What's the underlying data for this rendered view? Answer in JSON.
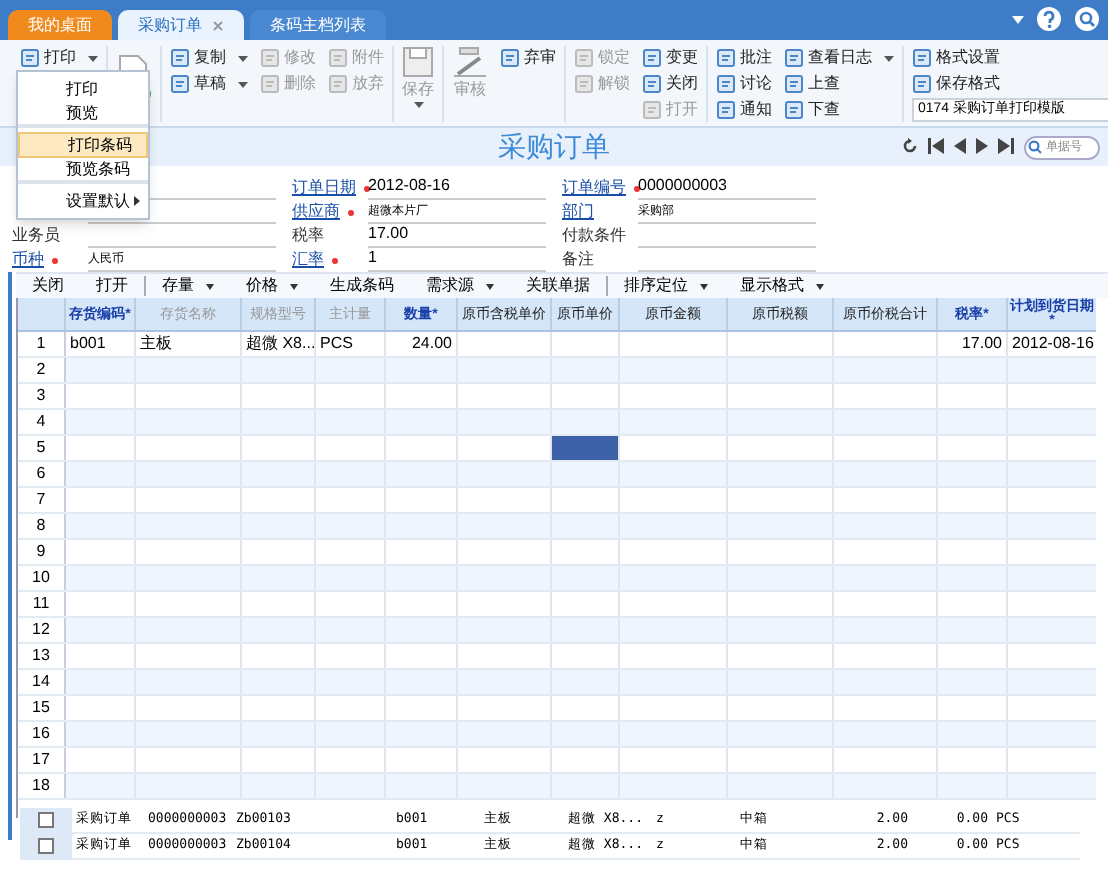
{
  "tabs": [
    {
      "label": "我的桌面",
      "selected": false,
      "kind": "home"
    },
    {
      "label": "采购订单",
      "selected": true,
      "kind": "doc",
      "closable": true
    },
    {
      "label": "条码主档列表",
      "selected": false,
      "kind": "doc"
    }
  ],
  "ribbon": {
    "groups": [
      {
        "columns": [
          [
            {
              "kind": "small",
              "label": "打印",
              "dropdown": true,
              "disabled": false
            }
          ]
        ]
      },
      {
        "columns": [
          [
            {
              "kind": "new"
            }
          ]
        ]
      },
      {
        "columns": [
          [
            {
              "kind": "small",
              "label": "复制",
              "dropdown": true,
              "disabled": false
            },
            {
              "kind": "small",
              "label": "草稿",
              "dropdown": true,
              "disabled": false
            }
          ],
          [
            {
              "kind": "small",
              "label": "修改",
              "disabled": true
            },
            {
              "kind": "small",
              "label": "删除",
              "disabled": true
            }
          ],
          [
            {
              "kind": "small",
              "label": "附件",
              "disabled": true
            },
            {
              "kind": "small",
              "label": "放弃",
              "disabled": true
            }
          ]
        ]
      },
      {
        "columns": [
          [
            {
              "kind": "save",
              "label": "保存",
              "dropdown": true,
              "disabled": true
            }
          ]
        ]
      },
      {
        "columns": [
          [
            {
              "kind": "approve",
              "label": "审核",
              "disabled": true
            }
          ],
          [
            {
              "kind": "small",
              "label": "弃审",
              "disabled": false
            }
          ]
        ]
      },
      {
        "columns": [
          [
            {
              "kind": "small",
              "label": "锁定",
              "disabled": true
            },
            {
              "kind": "small",
              "label": "解锁",
              "disabled": true
            }
          ],
          [
            {
              "kind": "small",
              "label": "变更",
              "disabled": false
            },
            {
              "kind": "small",
              "label": "关闭",
              "disabled": false
            },
            {
              "kind": "small",
              "label": "打开",
              "disabled": true
            }
          ]
        ]
      },
      {
        "columns": [
          [
            {
              "kind": "small",
              "label": "批注",
              "disabled": false
            },
            {
              "kind": "small",
              "label": "讨论",
              "disabled": false
            },
            {
              "kind": "small",
              "label": "通知",
              "disabled": false
            }
          ],
          [
            {
              "kind": "small",
              "label": "查看日志",
              "dropdown": true,
              "disabled": false
            },
            {
              "kind": "small",
              "label": "上查",
              "disabled": false
            },
            {
              "kind": "small",
              "label": "下查",
              "disabled": false
            }
          ]
        ]
      },
      {
        "columns": [
          [
            {
              "kind": "small",
              "label": "格式设置",
              "disabled": false
            },
            {
              "kind": "small",
              "label": "保存格式",
              "disabled": false
            },
            {
              "kind": "select",
              "value": "0174 采购订单打印模版"
            }
          ]
        ]
      }
    ]
  },
  "menu": [
    {
      "label": "打印",
      "selected": false
    },
    {
      "label": "预览",
      "selected": false,
      "separator_after": true
    },
    {
      "label": "打印条码",
      "selected": true
    },
    {
      "label": "预览条码",
      "selected": false,
      "separator_after": true
    },
    {
      "label": "设置默认",
      "selected": false,
      "submenu": true
    }
  ],
  "form": {
    "title": "采购订单",
    "search": {
      "placeholder": "单据号"
    },
    "columns": [
      [
        null,
        null,
        {
          "label": "业务员",
          "required": false,
          "link": false
        },
        {
          "label": "币种",
          "required": true,
          "link": true,
          "value": "人民币",
          "small": true
        }
      ],
      [
        {
          "label": "订单日期",
          "required": true,
          "link": true,
          "value": "2012-08-16"
        },
        {
          "label": "供应商",
          "required": true,
          "link": true,
          "value": "超微本片厂",
          "small": true
        },
        {
          "label": "税率",
          "required": false,
          "link": false,
          "value": "17.00"
        },
        {
          "label": "汇率",
          "required": true,
          "link": true,
          "value": "1"
        }
      ],
      [
        {
          "label": "订单编号",
          "required": true,
          "link": true,
          "value": "0000000003"
        },
        {
          "label": "部门",
          "required": false,
          "link": true,
          "value": "采购部",
          "small": true
        },
        {
          "label": "付款条件",
          "required": false,
          "link": false
        },
        {
          "label": "备注",
          "required": false,
          "link": false
        }
      ]
    ]
  },
  "grid_toolbar": [
    {
      "label": "关闭"
    },
    {
      "label": "打开",
      "separator_after": true
    },
    {
      "label": "存量",
      "dropdown": true
    },
    {
      "label": "价格",
      "dropdown": true
    },
    {
      "label": "生成条码"
    },
    {
      "label": "需求源",
      "dropdown": true
    },
    {
      "label": "关联单据",
      "separator_after": true
    },
    {
      "label": "排序定位",
      "dropdown": true
    },
    {
      "label": "显示格式",
      "dropdown": true
    }
  ],
  "grid": {
    "columns": [
      {
        "label": "存货编码*",
        "kind": "required"
      },
      {
        "label": "存货名称",
        "kind": "readonly"
      },
      {
        "label": "规格型号",
        "kind": "readonly"
      },
      {
        "label": "主计量",
        "kind": "readonly"
      },
      {
        "label": "数量*",
        "kind": "required"
      },
      {
        "label": "原币含税单价",
        "kind": "normal"
      },
      {
        "label": "原币单价",
        "kind": "normal"
      },
      {
        "label": "原币金额",
        "kind": "normal"
      },
      {
        "label": "原币税额",
        "kind": "normal"
      },
      {
        "label": "原币价税合计",
        "kind": "normal"
      },
      {
        "label": "税率*",
        "kind": "required"
      },
      {
        "label": "计划到货日期\n*",
        "kind": "required"
      }
    ],
    "rows": [
      {
        "number": "1",
        "cells": [
          "b001",
          "主板",
          "超微 X8...",
          "PCS",
          "24.00",
          null,
          null,
          null,
          null,
          null,
          "17.00",
          "2012-08-16"
        ]
      },
      {
        "number": "2"
      },
      {
        "number": "3"
      },
      {
        "number": "4"
      },
      {
        "number": "5",
        "cells": [
          null,
          null,
          null,
          null,
          null,
          null,
          {
            "selected": true
          },
          null,
          null,
          null,
          null,
          null
        ]
      },
      {
        "number": "6"
      },
      {
        "number": "7"
      },
      {
        "number": "8"
      },
      {
        "number": "9"
      },
      {
        "number": "10"
      },
      {
        "number": "11"
      },
      {
        "number": "12"
      },
      {
        "number": "13"
      },
      {
        "number": "14"
      },
      {
        "number": "15"
      },
      {
        "number": "16"
      },
      {
        "number": "17"
      },
      {
        "number": "18"
      }
    ]
  },
  "barcode_list": {
    "rows": [
      {
        "checked": false,
        "cells": [
          "采购订单",
          "0000000003",
          "Zb00103",
          "b001",
          "主板",
          "超微 X8...",
          "z",
          "中箱",
          "2.00",
          "0.00",
          "PCS"
        ]
      },
      {
        "checked": false,
        "cells": [
          "采购订单",
          "0000000003",
          "Zb00104",
          "b001",
          "主板",
          "超微 X8...",
          "z",
          "中箱",
          "2.00",
          "0.00",
          "PCS"
        ]
      }
    ]
  }
}
